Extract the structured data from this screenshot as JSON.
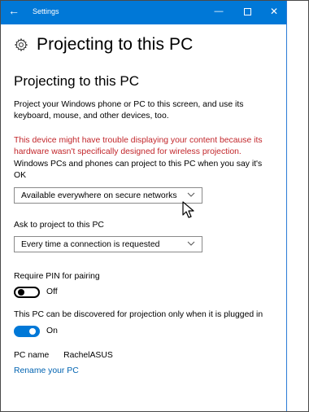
{
  "titlebar": {
    "back_glyph": "←",
    "title": "Settings",
    "minimize_glyph": "—",
    "close_glyph": "✕"
  },
  "header": {
    "icon": "gear-icon",
    "title": "Projecting to this PC"
  },
  "section": {
    "heading": "Projecting to this PC",
    "description": "Project your Windows phone or PC to this screen, and use its keyboard, mouse, and other devices, too.",
    "warning": "This device might have trouble displaying your content because its hardware wasn't specifically designed for wireless projection.",
    "availability_label": "Windows PCs and phones can project to this PC when you say it's OK",
    "availability_value": "Available everywhere on secure networks",
    "ask_label": "Ask to project to this PC",
    "ask_value": "Every time a connection is requested",
    "pin_label": "Require PIN for pairing",
    "pin_state": "Off",
    "plugged_label": "This PC can be discovered for projection only when it is plugged in",
    "plugged_state": "On",
    "pc_name_label": "PC name",
    "pc_name_value": "RachelASUS",
    "rename_link": "Rename your PC"
  },
  "colors": {
    "accent": "#0078d7",
    "warning": "#c2262b",
    "link": "#0063b1"
  }
}
